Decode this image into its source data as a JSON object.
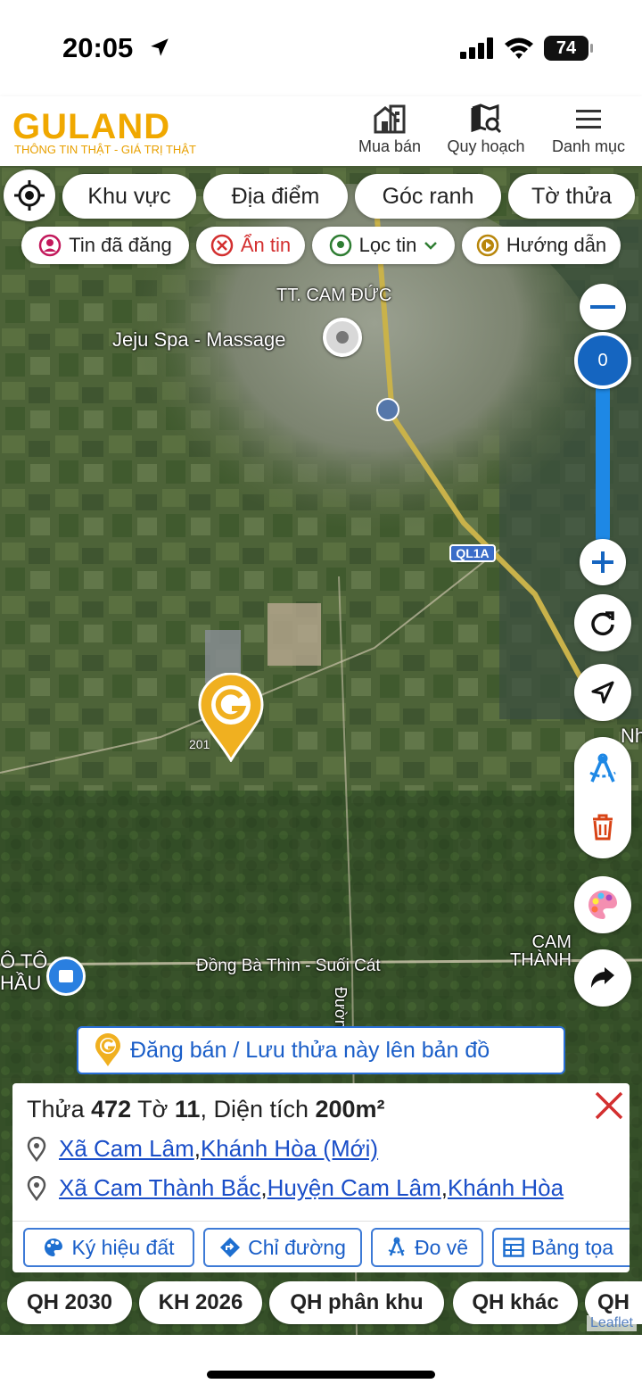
{
  "status_bar": {
    "time": "20:05",
    "battery": "74"
  },
  "app": {
    "logo": "GULAND",
    "tagline": "THÔNG TIN THẬT - GIÁ TRỊ THẬT",
    "nav": [
      {
        "label": "Mua bán",
        "icon": "building-icon"
      },
      {
        "label": "Quy hoạch",
        "icon": "map-search-icon"
      },
      {
        "label": "Danh mục",
        "icon": "menu-icon"
      }
    ]
  },
  "search_chips": [
    "Khu vực",
    "Địa điểm",
    "Góc ranh",
    "Tờ thửa"
  ],
  "filter_chips": [
    {
      "label": "Tin đã đăng",
      "icon": "user-circle-icon",
      "color": "#c2185b"
    },
    {
      "label": "Ẩn tin",
      "icon": "close-circle-icon",
      "color": "#d32f2f"
    },
    {
      "label": "Lọc tin",
      "icon": "location-icon",
      "color": "#2e7d32"
    },
    {
      "label": "Hướng dẫn",
      "icon": "play-icon",
      "color": "#b8860b"
    }
  ],
  "map": {
    "labels": {
      "town": "TT. CAM ĐỨC",
      "spa": "Jeju Spa - Massage",
      "road": "QL1A",
      "marker_num": "201",
      "nh": "Nh",
      "cam_thanh": "CAM\nTHÀNH",
      "dong_ba_thin": "Đồng Bà Thìn - Suối Cát",
      "duong": "Đườn",
      "oto": "Ô TÔ\nHẦU"
    },
    "zoom_level": "0",
    "leaflet": "Leaflet"
  },
  "banner": {
    "text": "Đăng bán / Lưu thửa này lên bản đồ"
  },
  "info_card": {
    "title_prefix": "Thửa ",
    "parcel": "472",
    "sheet_prefix": " Tờ ",
    "sheet": "11",
    "area_prefix": ", Diện tích ",
    "area": "200m²",
    "address_new": {
      "commune": "Xã Cam Lâm",
      "sep": ", ",
      "province": "Khánh Hòa (Mới)"
    },
    "address_old": {
      "commune": "Xã Cam Thành Bắc",
      "sep1": ", ",
      "district": "Huyện Cam Lâm",
      "sep2": ", ",
      "province": "Khánh Hòa"
    },
    "actions": [
      {
        "label": "Ký hiệu đất",
        "icon": "palette-icon"
      },
      {
        "label": "Chỉ đường",
        "icon": "directions-icon"
      },
      {
        "label": "Đo vẽ",
        "icon": "measure-icon"
      },
      {
        "label": "Bảng tọa",
        "icon": "table-icon"
      }
    ]
  },
  "planning_chips": [
    "QH 2030",
    "KH 2026",
    "QH phân khu",
    "QH khác",
    "QH"
  ]
}
